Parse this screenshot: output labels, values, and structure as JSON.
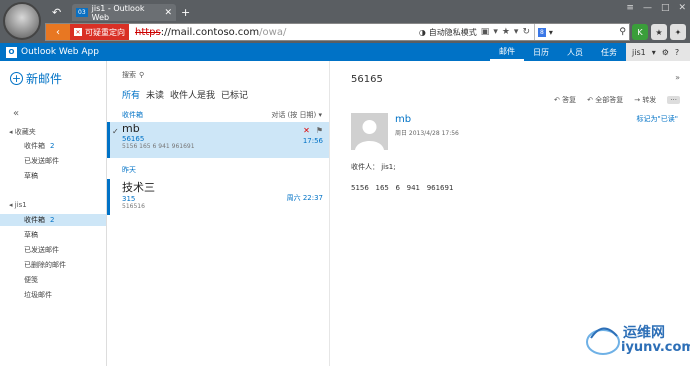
{
  "browser": {
    "tab_title": "jis1 - Outlook Web",
    "tab_favicon_text": "03",
    "cert_warning": "可疑重定向",
    "url_scheme": "https",
    "url_host": "://mail.contoso.com",
    "url_path": "/owa/",
    "privacy_mode": "自动隐私模式",
    "search_engine_badge": "8"
  },
  "owa": {
    "app_name": "Outlook Web App",
    "logo_letter": "O",
    "nav": [
      {
        "label": "邮件",
        "active": true
      },
      {
        "label": "日历"
      },
      {
        "label": "人员"
      },
      {
        "label": "任务"
      }
    ],
    "user": "jis1"
  },
  "leftnav": {
    "new_mail": "新邮件",
    "favorites_header": "收藏夹",
    "favorites": [
      {
        "label": "收件箱",
        "count": "2"
      },
      {
        "label": "已发送邮件",
        "count": ""
      },
      {
        "label": "草稿",
        "count": ""
      }
    ],
    "account_header": "jis1",
    "folders": [
      {
        "label": "收件箱",
        "count": "2"
      },
      {
        "label": "草稿",
        "count": ""
      },
      {
        "label": "已发送邮件",
        "count": ""
      },
      {
        "label": "已删除的邮件",
        "count": ""
      },
      {
        "label": "便笺",
        "count": ""
      },
      {
        "label": "垃圾邮件",
        "count": ""
      }
    ]
  },
  "list": {
    "search_label": "搜索",
    "filters": [
      "所有",
      "未读",
      "收件人是我",
      "已标记"
    ],
    "folder_label": "收件箱",
    "sort_label": "对话 (按 日期)",
    "day_separator": "昨天",
    "messages": [
      {
        "from": "mb",
        "subject": "56165",
        "preview": "5156 165 6 941 961691",
        "time": "17:56"
      },
      {
        "from": "技术三",
        "subject": "315",
        "preview": "516516",
        "time": "周六 22:37"
      }
    ]
  },
  "reading": {
    "subject": "56165",
    "actions": [
      "答复",
      "全部答复",
      "转发"
    ],
    "mark_unread": "标记为\"已读\"",
    "sender": "mb",
    "date": "周日 2013/4/28 17:56",
    "to_label": "收件人：",
    "to_value": "jis1;",
    "body": "5156   165   6   941   961691"
  },
  "watermark": {
    "line1": "运维网",
    "line2": "iyunv.com"
  }
}
